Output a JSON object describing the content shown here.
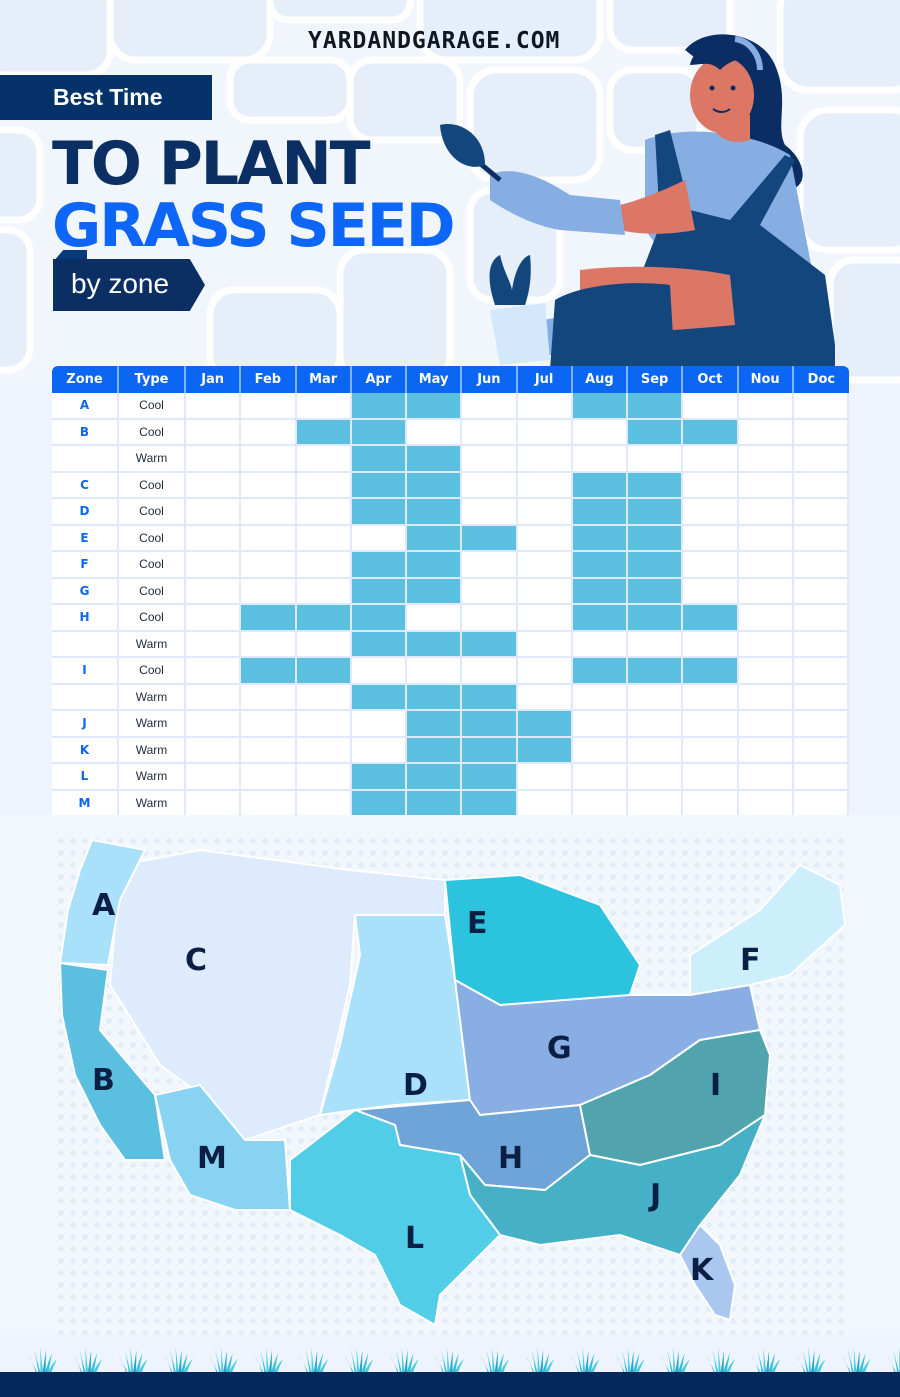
{
  "header": {
    "site_url": "YARDANDGARAGE.COM",
    "kicker": "Best Time",
    "title_line1": "TO PLANT",
    "title_line2": "GRASS SEED",
    "subtitle": "by zone"
  },
  "colors": {
    "navy": "#0b2f63",
    "brand_blue": "#0d66f5",
    "table_header": "#0a66f3",
    "planting_cell": "#5bbfe0",
    "grid_line": "#deeafb"
  },
  "table": {
    "headers": [
      "Zone",
      "Type",
      "Jan",
      "Feb",
      "Mar",
      "Apr",
      "May",
      "Jun",
      "Jul",
      "Aug",
      "Sep",
      "Oct",
      "Nou",
      "Doc"
    ],
    "rows": [
      {
        "zone": "A",
        "type": "Cool",
        "months": [
          0,
          0,
          0,
          1,
          1,
          0,
          0,
          1,
          1,
          0,
          0,
          0
        ]
      },
      {
        "zone": "B",
        "type": "Cool",
        "months": [
          0,
          0,
          1,
          1,
          0,
          0,
          0,
          0,
          1,
          1,
          0,
          0
        ]
      },
      {
        "zone": "",
        "type": "Warm",
        "months": [
          0,
          0,
          0,
          1,
          1,
          0,
          0,
          0,
          0,
          0,
          0,
          0
        ]
      },
      {
        "zone": "C",
        "type": "Cool",
        "months": [
          0,
          0,
          0,
          1,
          1,
          0,
          0,
          1,
          1,
          0,
          0,
          0
        ]
      },
      {
        "zone": "D",
        "type": "Cool",
        "months": [
          0,
          0,
          0,
          1,
          1,
          0,
          0,
          1,
          1,
          0,
          0,
          0
        ]
      },
      {
        "zone": "E",
        "type": "Cool",
        "months": [
          0,
          0,
          0,
          0,
          1,
          1,
          0,
          1,
          1,
          0,
          0,
          0
        ]
      },
      {
        "zone": "F",
        "type": "Cool",
        "months": [
          0,
          0,
          0,
          1,
          1,
          0,
          0,
          1,
          1,
          0,
          0,
          0
        ]
      },
      {
        "zone": "G",
        "type": "Cool",
        "months": [
          0,
          0,
          0,
          1,
          1,
          0,
          0,
          1,
          1,
          0,
          0,
          0
        ]
      },
      {
        "zone": "H",
        "type": "Cool",
        "months": [
          0,
          1,
          1,
          1,
          0,
          0,
          0,
          1,
          1,
          1,
          0,
          0
        ]
      },
      {
        "zone": "",
        "type": "Warm",
        "months": [
          0,
          0,
          0,
          1,
          1,
          1,
          0,
          0,
          0,
          0,
          0,
          0
        ]
      },
      {
        "zone": "I",
        "type": "Cool",
        "months": [
          0,
          1,
          1,
          0,
          0,
          0,
          0,
          1,
          1,
          1,
          0,
          0
        ]
      },
      {
        "zone": "",
        "type": "Warm",
        "months": [
          0,
          0,
          0,
          1,
          1,
          1,
          0,
          0,
          0,
          0,
          0,
          0
        ]
      },
      {
        "zone": "J",
        "type": "Warm",
        "months": [
          0,
          0,
          0,
          0,
          1,
          1,
          1,
          0,
          0,
          0,
          0,
          0
        ]
      },
      {
        "zone": "K",
        "type": "Warm",
        "months": [
          0,
          0,
          0,
          0,
          1,
          1,
          1,
          0,
          0,
          0,
          0,
          0
        ]
      },
      {
        "zone": "L",
        "type": "Warm",
        "months": [
          0,
          0,
          0,
          1,
          1,
          1,
          0,
          0,
          0,
          0,
          0,
          0
        ]
      },
      {
        "zone": "M",
        "type": "Warm",
        "months": [
          0,
          0,
          0,
          1,
          1,
          1,
          0,
          0,
          0,
          0,
          0,
          0
        ]
      }
    ]
  },
  "map": {
    "zones": [
      {
        "label": "A",
        "color": "#a9e0fa"
      },
      {
        "label": "B",
        "color": "#5bbfe0"
      },
      {
        "label": "C",
        "color": "#ddebfc"
      },
      {
        "label": "D",
        "color": "#a9e0fa"
      },
      {
        "label": "E",
        "color": "#2bc3dd"
      },
      {
        "label": "F",
        "color": "#cdeffc"
      },
      {
        "label": "G",
        "color": "#88aee4"
      },
      {
        "label": "H",
        "color": "#6fa4d8"
      },
      {
        "label": "I",
        "color": "#51a3ad"
      },
      {
        "label": "J",
        "color": "#46b1c6"
      },
      {
        "label": "K",
        "color": "#aac7ef"
      },
      {
        "label": "L",
        "color": "#52cde8"
      },
      {
        "label": "M",
        "color": "#87d3f1"
      }
    ]
  },
  "footer": {
    "grass_tufts": 20
  }
}
